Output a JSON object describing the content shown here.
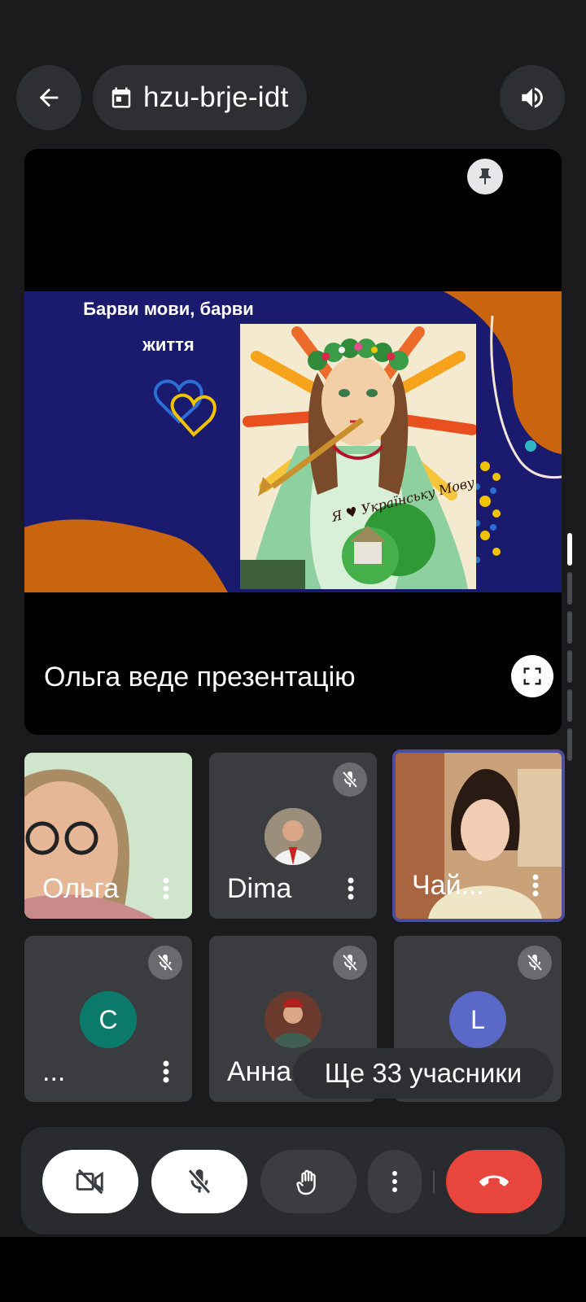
{
  "header": {
    "meeting_code": "hzu-brje-idt",
    "icons": [
      "back-arrow-icon",
      "calendar-icon",
      "speaker-icon"
    ]
  },
  "presentation": {
    "slide_title": "Барви мови, барви життя",
    "painting_caption": "Я ♥ Українську Мову",
    "presenter_label": "Ольга веде презентацію",
    "icons": [
      "pin-icon",
      "fullscreen-icon"
    ]
  },
  "participants": [
    {
      "name": "Ольга",
      "muted": false,
      "avatar": "video"
    },
    {
      "name": "Dima",
      "muted": true,
      "avatar": "photo"
    },
    {
      "name": "Чай...",
      "muted": false,
      "avatar": "video",
      "speaking": true
    },
    {
      "name": "...",
      "muted": true,
      "avatar": "letter",
      "initial": "C",
      "color": "#0b7a6b"
    },
    {
      "name": "Анна",
      "muted": true,
      "avatar": "photo"
    },
    {
      "name": "L",
      "muted": true,
      "avatar": "letter",
      "initial": "L",
      "color": "#5a69c7"
    }
  ],
  "more_participants": "Ще 33 учасники",
  "controls": {
    "camera": "camera-off-icon",
    "microphone": "mic-off-icon",
    "raise_hand": "hand-icon",
    "more": "more-vert-icon",
    "leave": "end-call-icon"
  },
  "colors": {
    "background": "#1b1b1d",
    "tile": "#3b3c40",
    "slide_blue": "#1a1b6e",
    "slide_orange": "#c9650e",
    "end_call": "#e8453c"
  }
}
